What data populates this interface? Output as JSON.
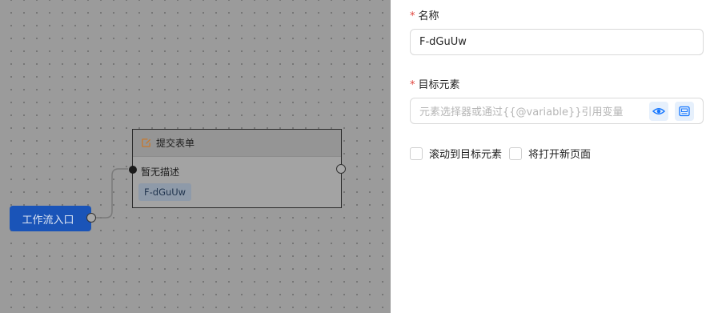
{
  "canvas": {
    "start_node": {
      "label": "工作流入口"
    },
    "form_node": {
      "title": "提交表单",
      "icon": "form-edit-icon",
      "description": "暂无描述",
      "tag": "F-dGuUw"
    }
  },
  "panel": {
    "name": {
      "required_mark": "*",
      "label": "名称",
      "value": "F-dGuUw"
    },
    "target": {
      "required_mark": "*",
      "label": "目标元素",
      "placeholder": "元素选择器或通过{{@variable}}引用变量",
      "buttons": [
        "eye-icon",
        "element-picker-icon"
      ]
    },
    "options": {
      "scroll_label": "滚动到目标元素",
      "new_page_label": "将打开新页面"
    }
  },
  "colors": {
    "accent": "#1a54b8",
    "required": "#e0443d",
    "icon_button_bg": "#e6f0fc",
    "icon_blue": "#1677ff"
  }
}
